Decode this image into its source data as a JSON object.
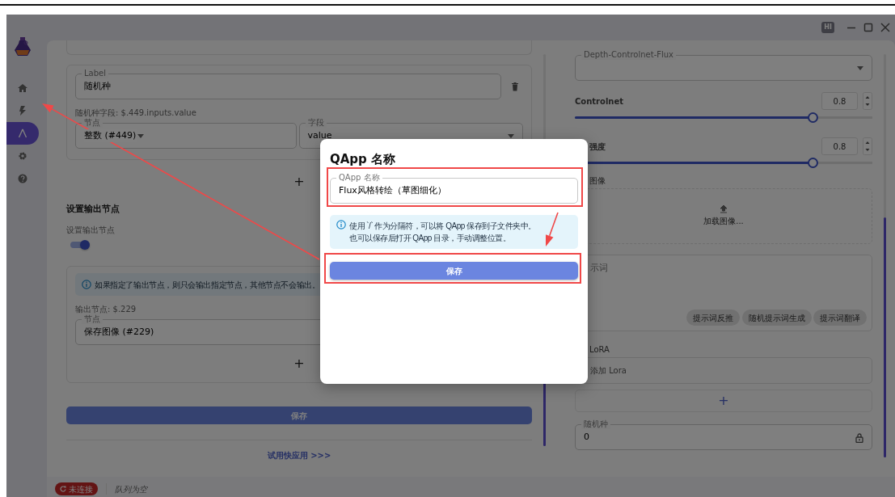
{
  "title_bar": {
    "chat_icon_text": "HI"
  },
  "sidebar": {
    "items": [
      {
        "kind": "home",
        "selected": false
      },
      {
        "kind": "flash",
        "selected": false
      },
      {
        "kind": "compass",
        "selected": true
      },
      {
        "kind": "gear",
        "selected": false
      },
      {
        "kind": "help",
        "selected": false
      }
    ]
  },
  "left_panel": {
    "seed_card": {
      "label_field": {
        "label": "Label",
        "value": "随机种"
      },
      "path": "随机种字段: $.449.inputs.value",
      "node_field": {
        "label": "节点",
        "value": "整数 (#449)"
      },
      "field_field": {
        "label": "字段",
        "value": "value"
      }
    },
    "add_button": "+",
    "output_section": {
      "heading": "设置输出节点",
      "switch": {
        "label": "设置输出节点",
        "on": true
      },
      "alert": "如果指定了输出节点，则只会输出指定节点，其他节点不会输出。",
      "path": "输出节点: $.229",
      "node_field": {
        "label": "节点",
        "value": "保存图像 (#229)"
      },
      "add_button": "+"
    },
    "save_button": "保存",
    "try_link": "试用快应用 >>>"
  },
  "right_panel": {
    "model_field": {
      "label": "Depth-Controlnet-Flux"
    },
    "sliders": [
      {
        "label": "Controlnet",
        "value": "0.8",
        "level": 0.8
      },
      {
        "label": "强度",
        "value": "0.8",
        "level": 0.8
      }
    ],
    "image_label": "图像",
    "upload_text": "加载图像...",
    "prompt": {
      "placeholder": "示词",
      "chips": [
        "提示词反推",
        "随机提示词生成",
        "提示词翻译"
      ]
    },
    "lora": {
      "label": "LoRA",
      "placeholder": "添加 Lora",
      "add_button": "+"
    },
    "seed_field": {
      "label": "随机种",
      "value": "0"
    }
  },
  "status_bar": {
    "connection": "未连接",
    "queue": "队列为空"
  },
  "dialog": {
    "title": "QApp 名称",
    "name_field": {
      "label": "QApp 名称",
      "value": "Flux风格转绘（草图细化）"
    },
    "info": [
      "使用 `/` 作为分隔符，可以将 QApp 保存到子文件夹中。",
      "也可以保存后打开 QApp 目录，手动调整位置。"
    ],
    "save_button": "保存"
  },
  "annotations": [
    {
      "kind": "box"
    },
    {
      "kind": "box"
    },
    {
      "kind": "arrow"
    },
    {
      "kind": "arrow"
    }
  ]
}
